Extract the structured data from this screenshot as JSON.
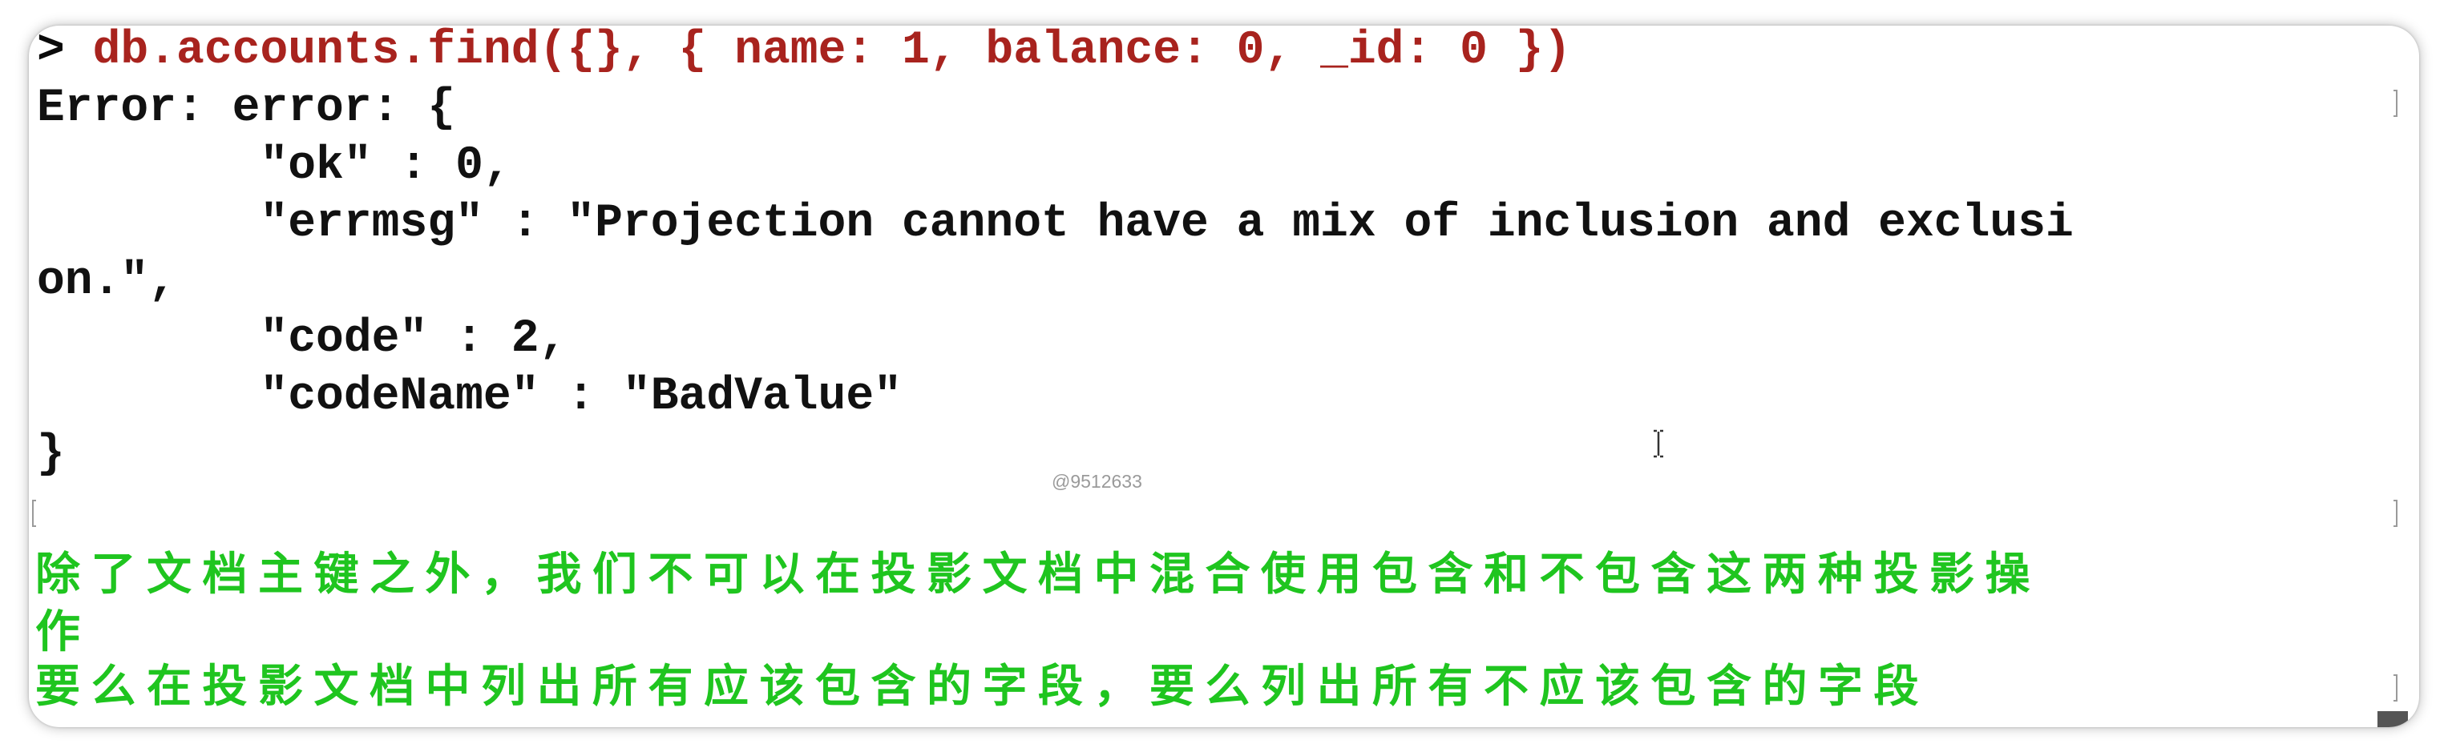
{
  "terminal": {
    "prompt": "> ",
    "command": "db.accounts.find({}, { name: 1, balance: 0, _id: 0 })",
    "output_lines": [
      "Error: error: {",
      "        \"ok\" : 0,",
      "        \"errmsg\" : \"Projection cannot have a mix of inclusion and exclusi",
      "on.\",",
      "        \"code\" : 2,",
      "        \"codeName\" : \"BadValue\"",
      "}"
    ],
    "annotation_line1": "除了文档主键之外，我们不可以在投影文档中混合使用包含和不包含这两种投影操",
    "annotation_line1b": "作",
    "annotation_line2": "要么在投影文档中列出所有应该包含的字段，要么列出所有不应该包含的字段",
    "watermark": "@9512633",
    "colors": {
      "command": "#a8231e",
      "output": "#111111",
      "annotation": "#1fc51f"
    },
    "icons": [
      "text-cursor-icon",
      "scroll-handle"
    ]
  }
}
